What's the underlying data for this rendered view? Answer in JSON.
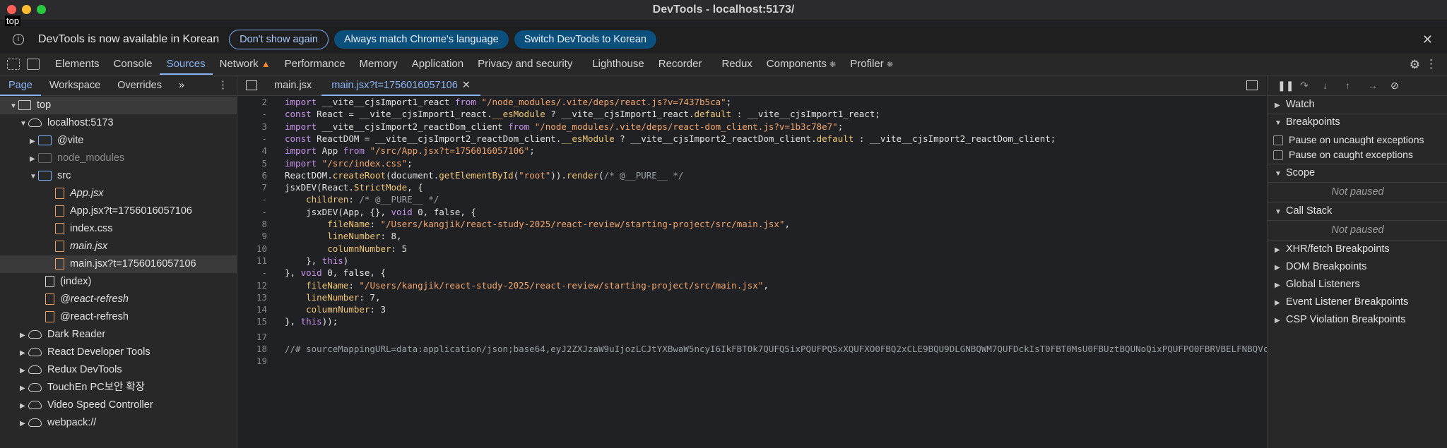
{
  "window": {
    "title": "DevTools - localhost:5173/",
    "tooltip": "top"
  },
  "infobar": {
    "message": "DevTools is now available in Korean",
    "btn_dont_show": "Don't show again",
    "btn_match": "Always match Chrome's language",
    "btn_switch": "Switch DevTools to Korean"
  },
  "panels": {
    "elements": "Elements",
    "console": "Console",
    "sources": "Sources",
    "network": "Network",
    "performance": "Performance",
    "memory": "Memory",
    "application": "Application",
    "privacy": "Privacy and security",
    "lighthouse": "Lighthouse",
    "recorder": "Recorder",
    "redux": "Redux",
    "components": "Components",
    "profiler": "Profiler"
  },
  "navigator": {
    "tabs": {
      "page": "Page",
      "workspace": "Workspace",
      "overrides": "Overrides",
      "more": "»"
    },
    "tree": [
      {
        "label": "top"
      },
      {
        "label": "localhost:5173"
      },
      {
        "label": "@vite"
      },
      {
        "label": "node_modules"
      },
      {
        "label": "src"
      },
      {
        "label": "App.jsx"
      },
      {
        "label": "App.jsx?t=1756016057106"
      },
      {
        "label": "index.css"
      },
      {
        "label": "main.jsx"
      },
      {
        "label": "main.jsx?t=1756016057106"
      },
      {
        "label": "(index)"
      },
      {
        "label": "@react-refresh"
      },
      {
        "label": "@react-refresh"
      },
      {
        "label": "Dark Reader"
      },
      {
        "label": "React Developer Tools"
      },
      {
        "label": "Redux DevTools"
      },
      {
        "label": "TouchEn PC보안 확장"
      },
      {
        "label": "Video Speed Controller"
      },
      {
        "label": "webpack://"
      }
    ]
  },
  "editor": {
    "tabs": [
      {
        "label": "main.jsx"
      },
      {
        "label": "main.jsx?t=1756016057106"
      }
    ],
    "lines": [
      {
        "n": "2",
        "tokens": [
          {
            "t": "import",
            "c": "kw"
          },
          {
            "t": " __vite__cjsImport1_react "
          },
          {
            "t": "from",
            "c": "kw"
          },
          {
            "t": " "
          },
          {
            "t": "\"/node_modules/.vite/deps/react.js?v=7437b5ca\"",
            "c": "str"
          },
          {
            "t": ";"
          }
        ]
      },
      {
        "n": "-",
        "tokens": [
          {
            "t": "const",
            "c": "kw"
          },
          {
            "t": " React = __vite__cjsImport1_react."
          },
          {
            "t": "__esModule",
            "c": "prop"
          },
          {
            "t": " ? __vite__cjsImport1_react."
          },
          {
            "t": "default",
            "c": "prop"
          },
          {
            "t": " : __vite__cjsImport1_react;"
          }
        ]
      },
      {
        "n": "3",
        "tokens": [
          {
            "t": "import",
            "c": "kw"
          },
          {
            "t": " __vite__cjsImport2_reactDom_client "
          },
          {
            "t": "from",
            "c": "kw"
          },
          {
            "t": " "
          },
          {
            "t": "\"/node_modules/.vite/deps/react-dom_client.js?v=1b3c78e7\"",
            "c": "str"
          },
          {
            "t": ";"
          }
        ]
      },
      {
        "n": "-",
        "tokens": [
          {
            "t": "const",
            "c": "kw"
          },
          {
            "t": " ReactDOM = __vite__cjsImport2_reactDom_client."
          },
          {
            "t": "__esModule",
            "c": "prop"
          },
          {
            "t": " ? __vite__cjsImport2_reactDom_client."
          },
          {
            "t": "default",
            "c": "prop"
          },
          {
            "t": " : __vite__cjsImport2_reactDom_client;"
          }
        ]
      },
      {
        "n": "4",
        "tokens": [
          {
            "t": "import",
            "c": "kw"
          },
          {
            "t": " App "
          },
          {
            "t": "from",
            "c": "kw"
          },
          {
            "t": " "
          },
          {
            "t": "\"/src/App.jsx?t=1756016057106\"",
            "c": "str"
          },
          {
            "t": ";"
          }
        ]
      },
      {
        "n": "5",
        "tokens": [
          {
            "t": "import",
            "c": "kw"
          },
          {
            "t": " "
          },
          {
            "t": "\"/src/index.css\"",
            "c": "str"
          },
          {
            "t": ";"
          }
        ]
      },
      {
        "n": "6",
        "tokens": [
          {
            "t": "ReactDOM."
          },
          {
            "t": "createRoot",
            "c": "prop"
          },
          {
            "t": "(document."
          },
          {
            "t": "getElementById",
            "c": "prop"
          },
          {
            "t": "("
          },
          {
            "t": "\"root\"",
            "c": "str"
          },
          {
            "t": "))."
          },
          {
            "t": "render",
            "c": "prop"
          },
          {
            "t": "("
          },
          {
            "t": "/* @__PURE__ */",
            "c": "cm"
          }
        ]
      },
      {
        "n": "7",
        "tokens": [
          {
            "t": "jsxDEV(React."
          },
          {
            "t": "StrictMode",
            "c": "prop"
          },
          {
            "t": ", {"
          }
        ]
      },
      {
        "n": "-",
        "tokens": [
          {
            "t": "    "
          },
          {
            "t": "children",
            "c": "prop"
          },
          {
            "t": ": "
          },
          {
            "t": "/* @__PURE__ */",
            "c": "cm"
          }
        ]
      },
      {
        "n": "-",
        "tokens": [
          {
            "t": "    jsxDEV(App, {}, "
          },
          {
            "t": "void",
            "c": "kw"
          },
          {
            "t": " 0, false, {"
          }
        ]
      },
      {
        "n": "8",
        "tokens": [
          {
            "t": "        "
          },
          {
            "t": "fileName",
            "c": "prop"
          },
          {
            "t": ": "
          },
          {
            "t": "\"/Users/kangjik/react-study-2025/react-review/starting-project/src/main.jsx\"",
            "c": "str"
          },
          {
            "t": ","
          }
        ]
      },
      {
        "n": "9",
        "tokens": [
          {
            "t": "        "
          },
          {
            "t": "lineNumber",
            "c": "prop"
          },
          {
            "t": ": 8,"
          }
        ]
      },
      {
        "n": "10",
        "tokens": [
          {
            "t": "        "
          },
          {
            "t": "columnNumber",
            "c": "prop"
          },
          {
            "t": ": 5"
          }
        ]
      },
      {
        "n": "11",
        "tokens": [
          {
            "t": "    }, "
          },
          {
            "t": "this",
            "c": "kw"
          },
          {
            "t": ")"
          }
        ]
      },
      {
        "n": "-",
        "tokens": [
          {
            "t": "}, "
          },
          {
            "t": "void",
            "c": "kw"
          },
          {
            "t": " 0, false, {"
          }
        ]
      },
      {
        "n": "12",
        "tokens": [
          {
            "t": "    "
          },
          {
            "t": "fileName",
            "c": "prop"
          },
          {
            "t": ": "
          },
          {
            "t": "\"/Users/kangjik/react-study-2025/react-review/starting-project/src/main.jsx\"",
            "c": "str"
          },
          {
            "t": ","
          }
        ]
      },
      {
        "n": "13",
        "tokens": [
          {
            "t": "    "
          },
          {
            "t": "lineNumber",
            "c": "prop"
          },
          {
            "t": ": 7,"
          }
        ]
      },
      {
        "n": "14",
        "tokens": [
          {
            "t": "    "
          },
          {
            "t": "columnNumber",
            "c": "prop"
          },
          {
            "t": ": 3"
          }
        ]
      },
      {
        "n": "15",
        "tokens": [
          {
            "t": "}, "
          },
          {
            "t": "this",
            "c": "kw"
          },
          {
            "t": "));"
          }
        ]
      },
      {
        "n": "17",
        "tokens": []
      },
      {
        "n": "18",
        "tokens": [
          {
            "t": "//# sourceMappingURL=data:application/json;base64,eyJ2ZXJzaW9uIjozLCJtYXBwaW5ncyI6IkFBT0k7QUFQSixPQUFPQSxXQUFXO0FBQ2xCLE9BQU9DLGNBQWM7QUFDckIsT0FBT0MsU0FBUztBQUNoQixPQUFPO0FBRVBELFNBQVc",
            "c": "cm"
          }
        ]
      },
      {
        "n": "19",
        "tokens": []
      }
    ]
  },
  "debugger": {
    "watch": "Watch",
    "breakpoints": "Breakpoints",
    "pause_uncaught": "Pause on uncaught exceptions",
    "pause_caught": "Pause on caught exceptions",
    "scope": "Scope",
    "not_paused_1": "Not paused",
    "call_stack": "Call Stack",
    "not_paused_2": "Not paused",
    "xhr": "XHR/fetch Breakpoints",
    "dom": "DOM Breakpoints",
    "global": "Global Listeners",
    "event": "Event Listener Breakpoints",
    "csp": "CSP Violation Breakpoints"
  }
}
